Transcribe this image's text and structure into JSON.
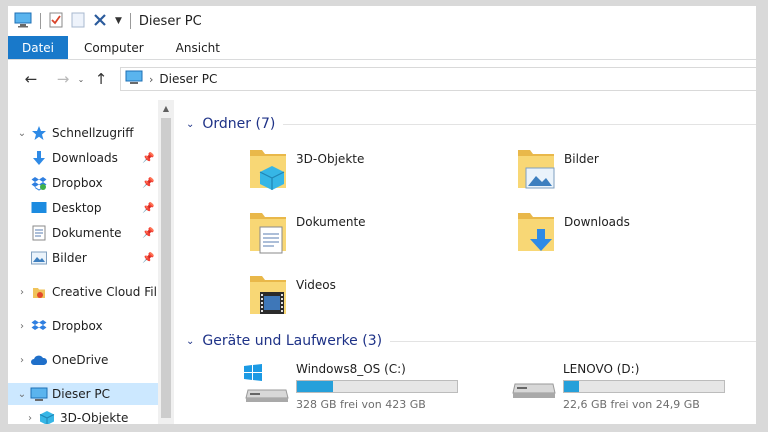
{
  "window": {
    "title": "Dieser PC"
  },
  "ribbon": {
    "tabs": [
      {
        "label": "Datei"
      },
      {
        "label": "Computer"
      },
      {
        "label": "Ansicht"
      }
    ]
  },
  "address": {
    "crumbs": [
      "Dieser PC"
    ]
  },
  "nav": {
    "quick_access": "Schnellzugriff",
    "quick_items": [
      {
        "label": "Downloads",
        "icon": "download-arrow-icon",
        "pinned": true
      },
      {
        "label": "Dropbox",
        "icon": "dropbox-icon",
        "pinned": true
      },
      {
        "label": "Desktop",
        "icon": "desktop-icon",
        "pinned": true
      },
      {
        "label": "Dokumente",
        "icon": "documents-icon",
        "pinned": true
      },
      {
        "label": "Bilder",
        "icon": "pictures-icon",
        "pinned": true
      }
    ],
    "roots": [
      {
        "label": "Creative Cloud Fil",
        "icon": "creative-cloud-icon"
      },
      {
        "label": "Dropbox",
        "icon": "dropbox-icon"
      },
      {
        "label": "OneDrive",
        "icon": "onedrive-icon"
      },
      {
        "label": "Dieser PC",
        "icon": "computer-icon",
        "selected": true
      }
    ],
    "pc_children": [
      {
        "label": "3D-Objekte",
        "icon": "3d-objects-icon"
      }
    ]
  },
  "content": {
    "folders_header": "Ordner (7)",
    "folders": [
      {
        "label": "3D-Objekte",
        "icon": "3d-objects-folder-icon"
      },
      {
        "label": "Bilder",
        "icon": "pictures-folder-icon"
      },
      {
        "label": "Dokumente",
        "icon": "documents-folder-icon"
      },
      {
        "label": "Downloads",
        "icon": "downloads-folder-icon"
      },
      {
        "label": "Videos",
        "icon": "videos-folder-icon"
      }
    ],
    "drives_header": "Geräte und Laufwerke (3)",
    "drives": [
      {
        "label": "Windows8_OS (C:)",
        "free": "328 GB frei von 423 GB",
        "used_fraction": 0.225
      },
      {
        "label": "LENOVO (D:)",
        "free": "22,6 GB frei von 24,9 GB",
        "used_fraction": 0.092
      }
    ]
  },
  "colors": {
    "accent": "#1979ca",
    "selection": "#cce8ff",
    "bar_fill": "#26a0da",
    "group_header": "#1e3287"
  }
}
